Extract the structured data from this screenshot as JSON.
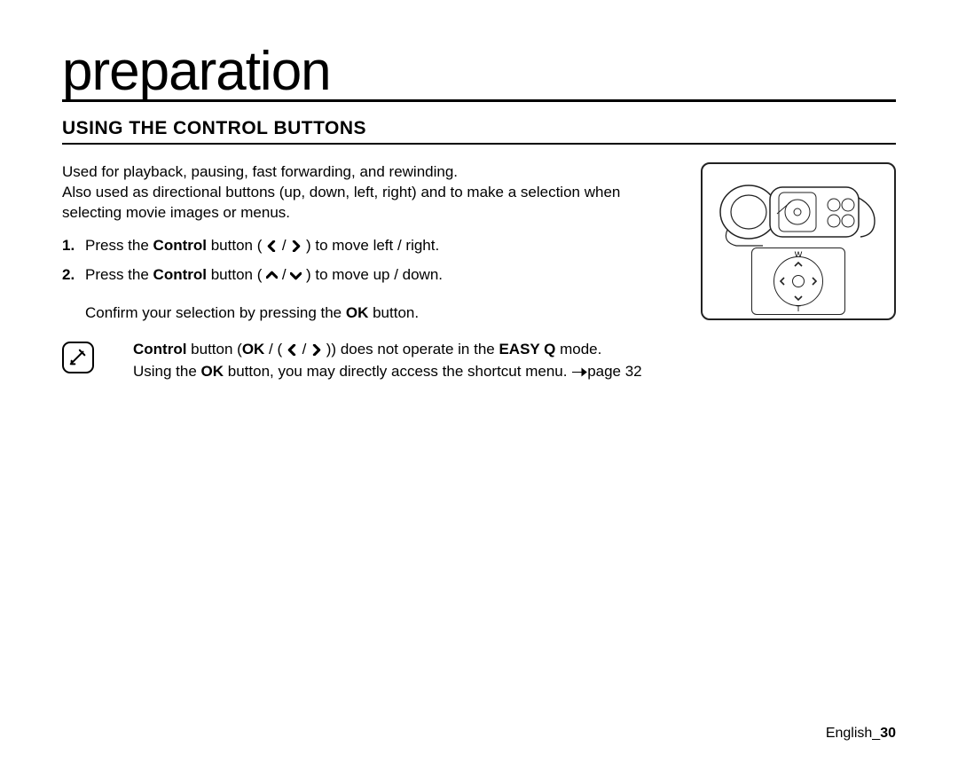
{
  "title": "preparation",
  "section_heading": "USING THE CONTROL BUTTONS",
  "intro_line1": "Used for playback, pausing, fast forwarding, and rewinding.",
  "intro_line2": "Also used as directional buttons (up, down, left, right) and to make a selection when selecting movie images or menus.",
  "steps": {
    "s1_a": "Press the ",
    "s1_b": "Control",
    "s1_c": " button  ( ",
    "s1_d": " / ",
    "s1_e": " ) to move left / right.",
    "s2_a": "Press the ",
    "s2_b": "Control",
    "s2_c": " button  ( ",
    "s2_d": " / ",
    "s2_e": " ) to move up / down.",
    "s2_sub_a": "Confirm your selection by pressing the ",
    "s2_sub_b": "OK",
    "s2_sub_c": " button."
  },
  "note": {
    "l1_a": "Control",
    "l1_b": " button (",
    "l1_c": "OK",
    "l1_d": " / ( ",
    "l1_e": " / ",
    "l1_f": " )) does not operate in the ",
    "l1_g": "EASY Q",
    "l1_h": " mode.",
    "l2_a": "Using the ",
    "l2_b": "OK",
    "l2_c": " button, you may directly access the shortcut menu. ",
    "l2_d": "page 32"
  },
  "dpad": {
    "top": "W",
    "bottom": "T"
  },
  "footer": {
    "lang": "English",
    "sep": "_",
    "page": "30"
  }
}
